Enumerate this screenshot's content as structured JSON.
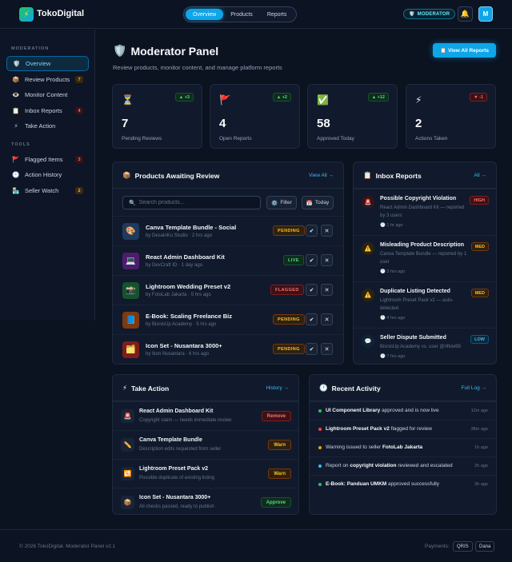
{
  "header": {
    "brand": "TokoDigital",
    "logo_icon": "⚡",
    "nav": [
      "Overview",
      "Products",
      "Reports"
    ],
    "mod_badge": "MODERATOR",
    "mod_badge_icon": "🛡️",
    "bell_icon": "🔔",
    "avatar": "M"
  },
  "sidebar": {
    "moderation_label": "MODERATION",
    "tools_label": "TOOLS",
    "moderation": [
      {
        "icon": "🛡️",
        "label": "Overview",
        "count": ""
      },
      {
        "icon": "📦",
        "label": "Review Products",
        "count": "7"
      },
      {
        "icon": "👁️",
        "label": "Monitor Content",
        "count": ""
      },
      {
        "icon": "📋",
        "label": "Inbox Reports",
        "count": "4"
      },
      {
        "icon": "⚡",
        "label": "Take Action",
        "count": ""
      }
    ],
    "tools": [
      {
        "icon": "🚩",
        "label": "Flagged Items",
        "count": "3"
      },
      {
        "icon": "🕐",
        "label": "Action History",
        "count": ""
      },
      {
        "icon": "🏪",
        "label": "Seller Watch",
        "count": "2"
      }
    ]
  },
  "main": {
    "title": "Moderator Panel",
    "title_icon": "🛡️",
    "subtitle": "Review products, monitor content, and manage platform reports",
    "view_reports_btn": "View All Reports",
    "view_reports_icon": "📋"
  },
  "stats": [
    {
      "icon": "⏳",
      "trend": "▲ +3",
      "value": "7",
      "label": "Pending Reviews"
    },
    {
      "icon": "🚩",
      "trend": "▲ +2",
      "value": "4",
      "label": "Open Reports"
    },
    {
      "icon": "✅",
      "trend": "▲ +12",
      "value": "58",
      "label": "Approved Today"
    },
    {
      "icon": "⚡",
      "trend": "▼ -1",
      "value": "2",
      "label": "Actions Taken"
    }
  ],
  "products_panel": {
    "title": "Products Awaiting Review",
    "icon": "📦",
    "link": "View All →",
    "search_placeholder": "Search products...",
    "search_icon": "🔍",
    "filter_label": "Filter",
    "filter_icon": "⚙️",
    "date_label": "Today",
    "date_icon": "📅",
    "approve_glyph": "✔",
    "reject_glyph": "✕",
    "items": [
      {
        "thumb": "🎨",
        "name": "Canva Template Bundle - Social",
        "meta": "by DesainKu Studio · 2 hrs ago",
        "status": "PENDING"
      },
      {
        "thumb": "💻",
        "name": "React Admin Dashboard Kit",
        "meta": "by DevCraft ID · 1 day ago",
        "status": "LIVE"
      },
      {
        "thumb": "📸",
        "name": "Lightroom Wedding Preset v2",
        "meta": "by FotoLab Jakarta · 5 hrs ago",
        "status": "FLAGGED"
      },
      {
        "thumb": "📘",
        "name": "E-Book: Scaling Freelance Biz",
        "meta": "by BisnisUp Academy · 5 hrs ago",
        "status": "PENDING"
      },
      {
        "thumb": "🗂️",
        "name": "Icon Set - Nusantara 3000+",
        "meta": "by Ikon Nusantara · 6 hrs ago",
        "status": "PENDING"
      }
    ]
  },
  "inbox_panel": {
    "title": "Inbox Reports",
    "icon": "📋",
    "link": "All →",
    "clock_icon": "🕐",
    "items": [
      {
        "icon": "🚨",
        "title": "Possible Copyright Violation",
        "desc": "React Admin Dashboard Kit — reported by 3 users",
        "time": "1 hr ago",
        "priority": "HIGH"
      },
      {
        "icon": "⚠️",
        "title": "Misleading Product Description",
        "desc": "Canva Template Bundle — reported by 1 user",
        "time": "3 hrs ago",
        "priority": "MED"
      },
      {
        "icon": "⚠️",
        "title": "Duplicate Listing Detected",
        "desc": "Lightroom Preset Pack v2 — auto-detected",
        "time": "4 hrs ago",
        "priority": "MED"
      },
      {
        "icon": "💬",
        "title": "Seller Dispute Submitted",
        "desc": "BisnisUp Academy vs. user @rifkiw99",
        "time": "7 hrs ago",
        "priority": "LOW"
      }
    ]
  },
  "action_panel": {
    "title": "Take Action",
    "icon": "⚡",
    "link": "History →",
    "items": [
      {
        "icon": "🚨",
        "title": "React Admin Dashboard Kit",
        "desc": "Copyright claim — needs immediate review",
        "button": "Remove"
      },
      {
        "icon": "✏️",
        "title": "Canva Template Bundle",
        "desc": "Description edits requested from seller",
        "button": "Warn"
      },
      {
        "icon": "🔁",
        "title": "Lightroom Preset Pack v2",
        "desc": "Possible duplicate of existing listing",
        "button": "Warn"
      },
      {
        "icon": "📦",
        "title": "Icon Set - Nusantara 3000+",
        "desc": "All checks passed, ready to publish",
        "button": "Approve"
      }
    ]
  },
  "activity_panel": {
    "title": "Recent Activity",
    "icon": "🕐",
    "link": "Full Log →",
    "items": [
      {
        "color": "#22c55e",
        "pre": "",
        "bold": "UI Component Library",
        "post": " approved and is now live",
        "time": "12m ago"
      },
      {
        "color": "#ef4444",
        "pre": "",
        "bold": "Lightroom Preset Pack v2",
        "post": " flagged for review",
        "time": "38m ago"
      },
      {
        "color": "#f59e0b",
        "pre": "Warning issued to seller ",
        "bold": "FotoLab Jakarta",
        "post": "",
        "time": "1h ago"
      },
      {
        "color": "#38bdf8",
        "pre": "Report on ",
        "bold": "copyright violation",
        "post": " reviewed and escalated",
        "time": "2h ago"
      },
      {
        "color": "#22c55e",
        "pre": "",
        "bold": "E-Book: Panduan UMKM",
        "post": " approved successfully",
        "time": "3h ago"
      }
    ]
  },
  "footer": {
    "copyright": "© 2026 TokoDigital. Moderator Panel v2.1",
    "payments_label": "Payments:",
    "payments": [
      "QRIS",
      "Dana"
    ]
  }
}
